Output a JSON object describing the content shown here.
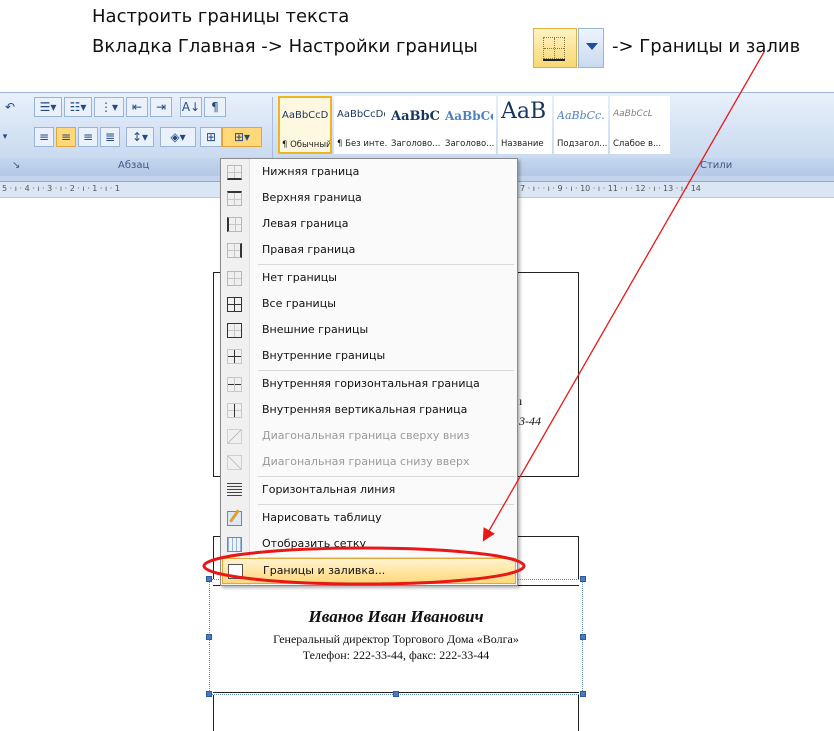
{
  "caption": {
    "line1": "Настроить границы текста",
    "line2_prefix": "Вкладка Главная -> Настройки границы",
    "line2_suffix": "-> Границы и залив"
  },
  "ribbon": {
    "paragraph_group": "Абзац",
    "styles_group": "Стили",
    "styles": [
      {
        "sample": "AaBbCcDc",
        "name": "¶ Обычный"
      },
      {
        "sample": "AaBbCcDc",
        "name": "¶ Без инте..."
      },
      {
        "sample": "AaBbCc",
        "name": "Заголово..."
      },
      {
        "sample": "AaBbCc",
        "name": "Заголово..."
      },
      {
        "sample": "AaB",
        "name": "Название"
      },
      {
        "sample": "AaBbCc.",
        "name": "Подзагол..."
      },
      {
        "sample": "AaBbCcL",
        "name": "Слабое в..."
      }
    ]
  },
  "ruler": {
    "left": "5 · ı · 4 · ı · 3 · ı · 2 · ı · 1 · ı · 1",
    "right": "7 · ı ·  · ı · 9 · ı · 10 · ı · 11 · ı · 12 · ı · 13 · ı · 14"
  },
  "menu": {
    "items": [
      {
        "label": "Нижняя граница",
        "icon": "border-bottom-icon",
        "disabled": false
      },
      {
        "label": "Верхняя граница",
        "icon": "border-top-icon",
        "disabled": false
      },
      {
        "label": "Левая граница",
        "icon": "border-left-icon",
        "disabled": false
      },
      {
        "label": "Правая граница",
        "icon": "border-right-icon",
        "disabled": false
      },
      {
        "label": "Нет границы",
        "icon": "no-border-icon",
        "disabled": false
      },
      {
        "label": "Все границы",
        "icon": "all-borders-icon",
        "disabled": false
      },
      {
        "label": "Внешние границы",
        "icon": "outside-borders-icon",
        "disabled": false
      },
      {
        "label": "Внутренние границы",
        "icon": "inside-borders-icon",
        "disabled": false
      },
      {
        "label": "Внутренняя горизонтальная граница",
        "icon": "inside-horizontal-border-icon",
        "disabled": false
      },
      {
        "label": "Внутренняя вертикальная граница",
        "icon": "inside-vertical-border-icon",
        "disabled": false
      },
      {
        "label": "Диагональная граница сверху вниз",
        "icon": "diagonal-down-border-icon",
        "disabled": true
      },
      {
        "label": "Диагональная граница снизу вверх",
        "icon": "diagonal-up-border-icon",
        "disabled": true
      },
      {
        "label": "Горизонтальная линия",
        "icon": "horizontal-line-icon",
        "disabled": false
      },
      {
        "label": "Нарисовать таблицу",
        "icon": "draw-table-icon",
        "disabled": false
      },
      {
        "label": "Отобразить сетку",
        "icon": "view-gridlines-icon",
        "disabled": false
      },
      {
        "label": "Границы и заливка...",
        "icon": "borders-shading-icon",
        "disabled": false
      }
    ]
  },
  "document": {
    "name": "Иванов Иван Иванович",
    "position": "Генеральный директор Торгового Дома «Волга»",
    "phone": "Телефон: 222-33-44, факс: 222-33-44",
    "partial_number": "3-44"
  },
  "colors": {
    "annotation": "#e81818",
    "highlight": "#ffd87a"
  }
}
